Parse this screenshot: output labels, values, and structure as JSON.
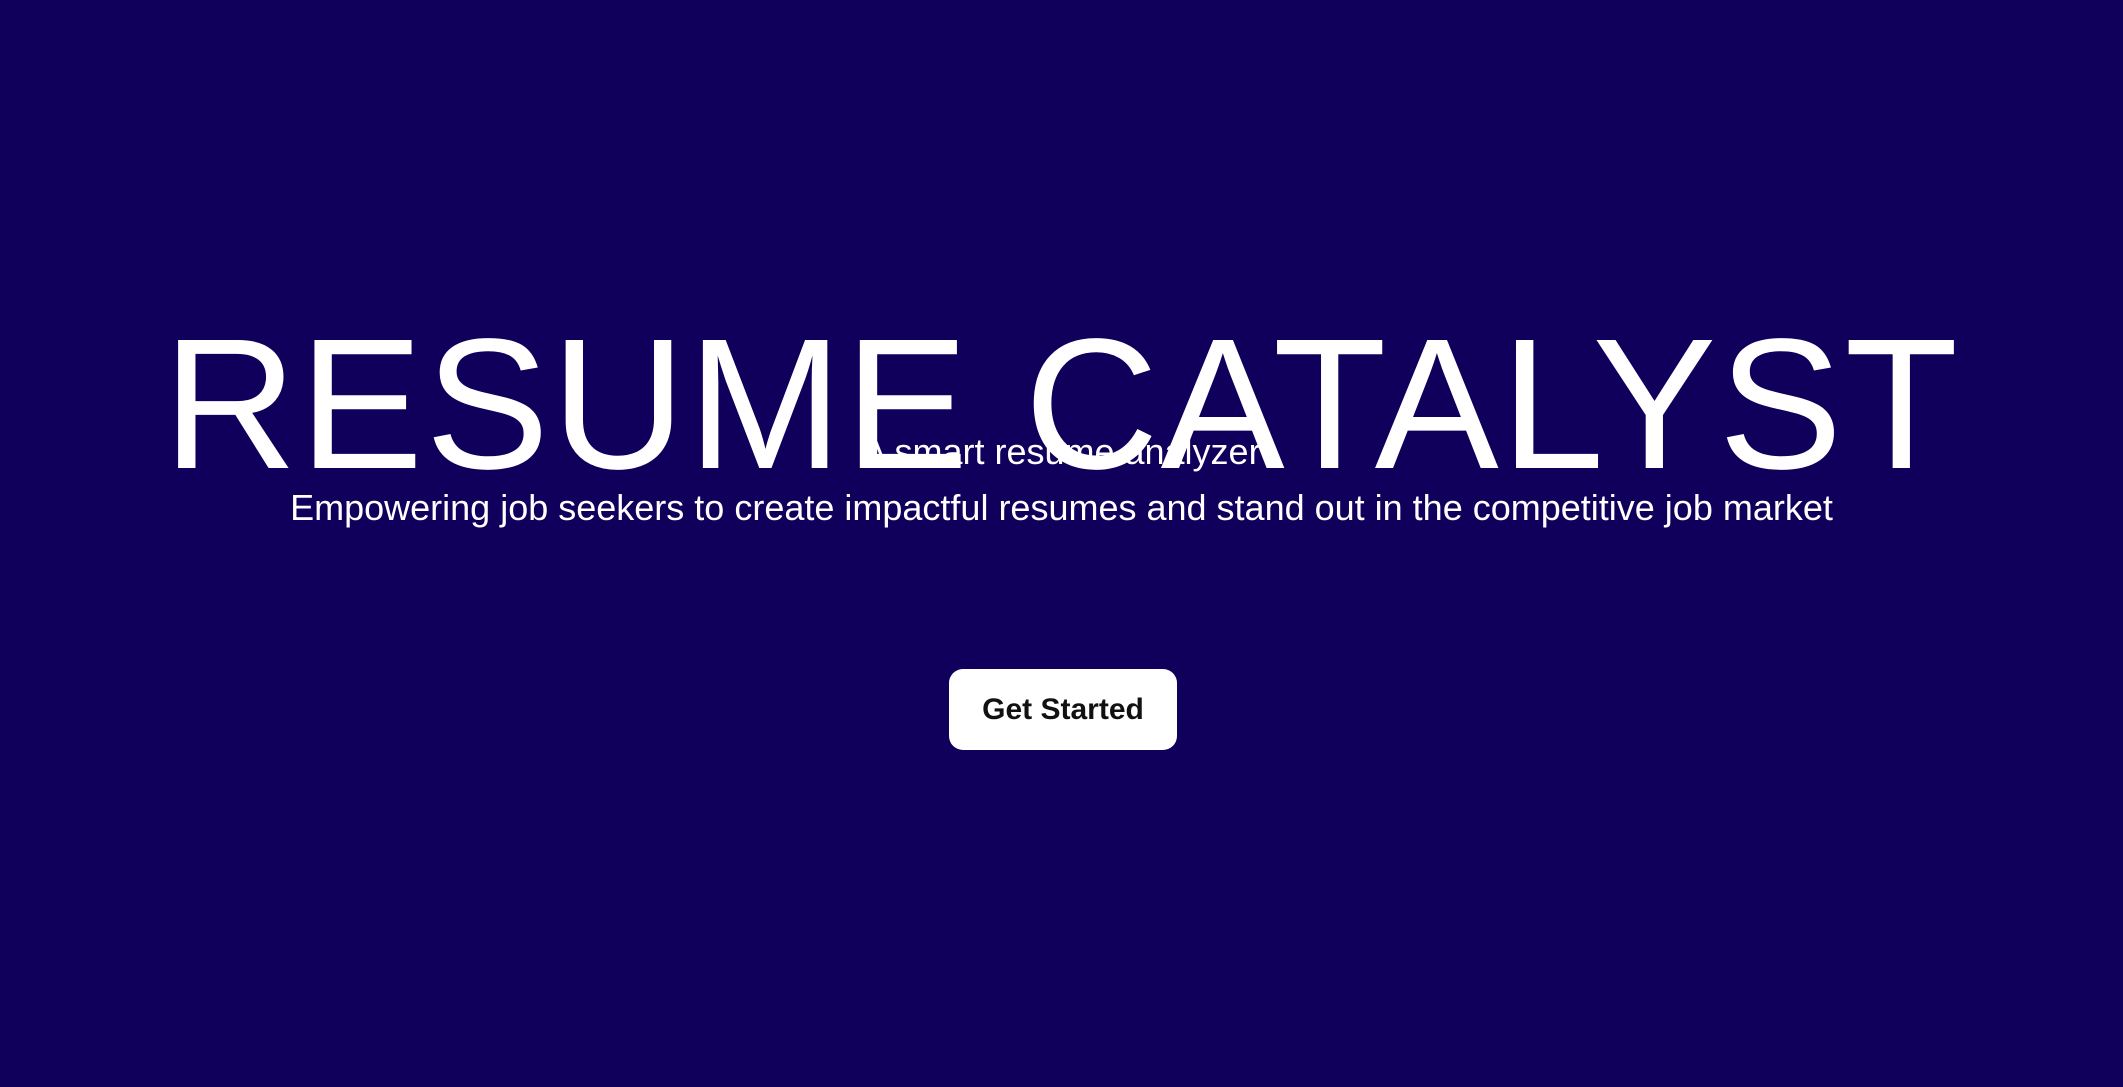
{
  "hero": {
    "title": "RESUME CATALYST",
    "tagline": "A smart resume analyzer",
    "description": "Empowering job seekers to create impactful resumes and stand out in the competitive job market",
    "cta_label": "Get Started"
  },
  "colors": {
    "background": "#10005c",
    "text": "#ffffff",
    "button_background": "#ffffff",
    "button_text": "#111111"
  }
}
